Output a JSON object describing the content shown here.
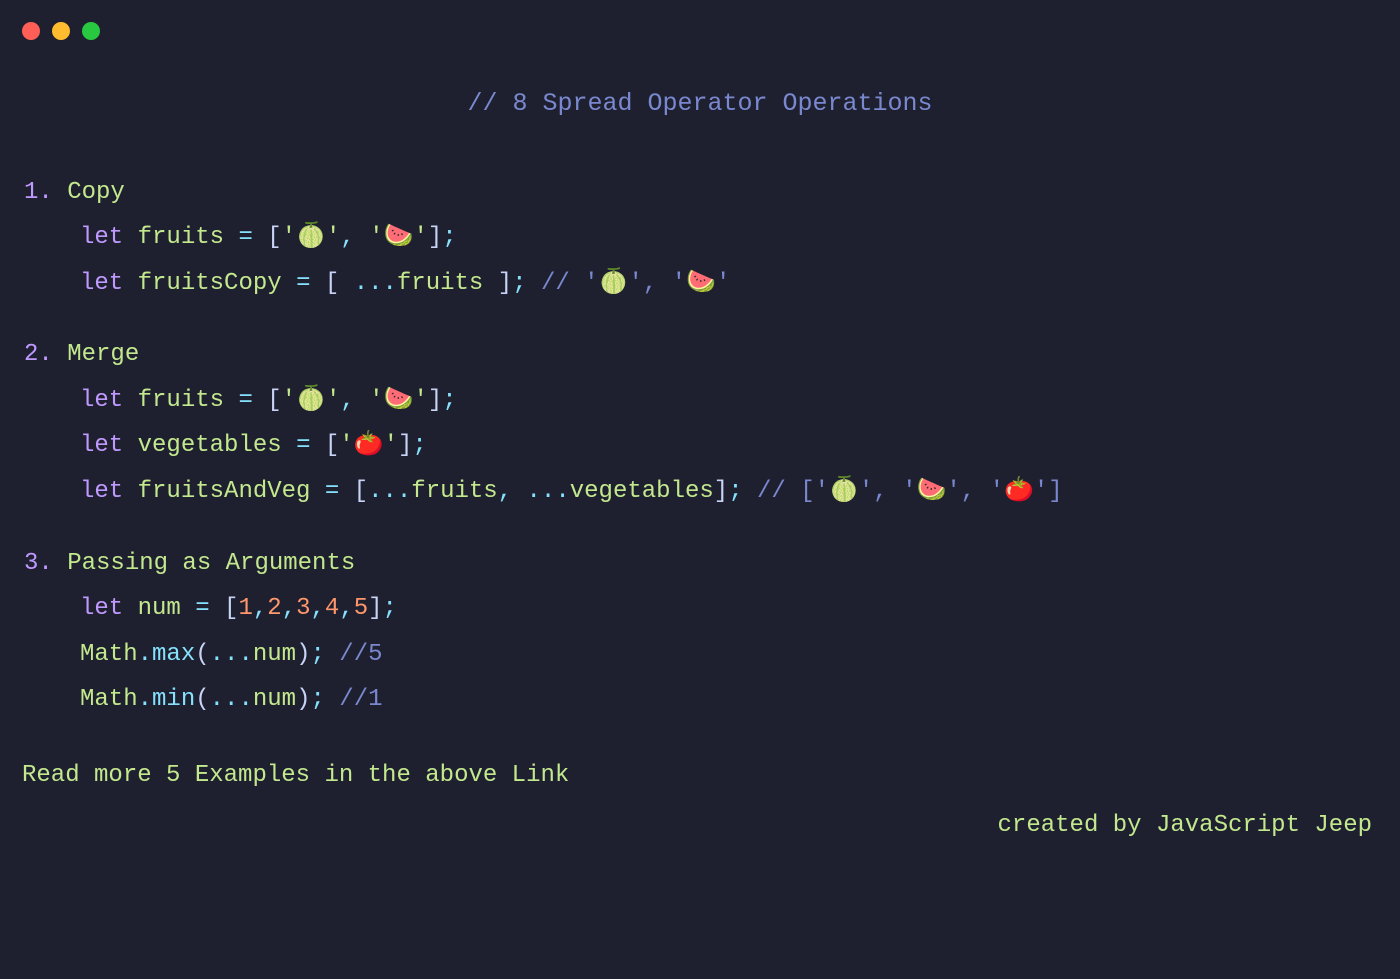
{
  "title_comment": "// 8 Spread Operator Operations",
  "sections": [
    {
      "num": "1.",
      "title": " Copy",
      "lines": [
        {
          "tokens": [
            {
              "c": "kw",
              "t": "let"
            },
            {
              "c": "text",
              "t": " "
            },
            {
              "c": "var",
              "t": "fruits"
            },
            {
              "c": "text",
              "t": " "
            },
            {
              "c": "punct",
              "t": "="
            },
            {
              "c": "text",
              "t": " ["
            },
            {
              "c": "str",
              "t": "'🍈'"
            },
            {
              "c": "punct",
              "t": ","
            },
            {
              "c": "text",
              "t": " "
            },
            {
              "c": "str",
              "t": "'🍉'"
            },
            {
              "c": "text",
              "t": "]"
            },
            {
              "c": "punct",
              "t": ";"
            }
          ]
        },
        {
          "tokens": [
            {
              "c": "kw",
              "t": "let"
            },
            {
              "c": "text",
              "t": " "
            },
            {
              "c": "var",
              "t": "fruitsCopy"
            },
            {
              "c": "text",
              "t": " "
            },
            {
              "c": "punct",
              "t": "="
            },
            {
              "c": "text",
              "t": " [ "
            },
            {
              "c": "punct",
              "t": "..."
            },
            {
              "c": "var",
              "t": "fruits"
            },
            {
              "c": "text",
              "t": " ]"
            },
            {
              "c": "punct",
              "t": ";"
            },
            {
              "c": "text",
              "t": " "
            },
            {
              "c": "comment",
              "t": "//  '🍈', '🍉'"
            }
          ]
        }
      ]
    },
    {
      "num": "2.",
      "title": " Merge",
      "lines": [
        {
          "tokens": [
            {
              "c": "kw",
              "t": "let"
            },
            {
              "c": "text",
              "t": " "
            },
            {
              "c": "var",
              "t": "fruits"
            },
            {
              "c": "text",
              "t": " "
            },
            {
              "c": "punct",
              "t": "="
            },
            {
              "c": "text",
              "t": " ["
            },
            {
              "c": "str",
              "t": "'🍈'"
            },
            {
              "c": "punct",
              "t": ","
            },
            {
              "c": "text",
              "t": " "
            },
            {
              "c": "str",
              "t": "'🍉'"
            },
            {
              "c": "text",
              "t": "]"
            },
            {
              "c": "punct",
              "t": ";"
            }
          ]
        },
        {
          "tokens": [
            {
              "c": "kw",
              "t": "let"
            },
            {
              "c": "text",
              "t": " "
            },
            {
              "c": "var",
              "t": "vegetables"
            },
            {
              "c": "text",
              "t": " "
            },
            {
              "c": "punct",
              "t": "="
            },
            {
              "c": "text",
              "t": " ["
            },
            {
              "c": "str",
              "t": "'🍅'"
            },
            {
              "c": "text",
              "t": "]"
            },
            {
              "c": "punct",
              "t": ";"
            }
          ]
        },
        {
          "tokens": [
            {
              "c": "kw",
              "t": "let"
            },
            {
              "c": "text",
              "t": " "
            },
            {
              "c": "var",
              "t": "fruitsAndVeg"
            },
            {
              "c": "text",
              "t": " "
            },
            {
              "c": "punct",
              "t": "="
            },
            {
              "c": "text",
              "t": " ["
            },
            {
              "c": "punct",
              "t": "..."
            },
            {
              "c": "var",
              "t": "fruits"
            },
            {
              "c": "punct",
              "t": ","
            },
            {
              "c": "text",
              "t": " "
            },
            {
              "c": "punct",
              "t": "..."
            },
            {
              "c": "var",
              "t": "vegetables"
            },
            {
              "c": "text",
              "t": "]"
            },
            {
              "c": "punct",
              "t": ";"
            },
            {
              "c": "text",
              "t": " "
            },
            {
              "c": "comment",
              "t": "// ['🍈', '🍉', '🍅']"
            }
          ]
        }
      ]
    },
    {
      "num": "3.",
      "title": " Passing as Arguments",
      "lines": [
        {
          "tokens": [
            {
              "c": "kw",
              "t": "let"
            },
            {
              "c": "text",
              "t": " "
            },
            {
              "c": "var",
              "t": "num"
            },
            {
              "c": "text",
              "t": " "
            },
            {
              "c": "punct",
              "t": "="
            },
            {
              "c": "text",
              "t": " ["
            },
            {
              "c": "number",
              "t": "1"
            },
            {
              "c": "punct",
              "t": ","
            },
            {
              "c": "number",
              "t": "2"
            },
            {
              "c": "punct",
              "t": ","
            },
            {
              "c": "number",
              "t": "3"
            },
            {
              "c": "punct",
              "t": ","
            },
            {
              "c": "number",
              "t": "4"
            },
            {
              "c": "punct",
              "t": ","
            },
            {
              "c": "number",
              "t": "5"
            },
            {
              "c": "text",
              "t": "]"
            },
            {
              "c": "punct",
              "t": ";"
            }
          ]
        },
        {
          "tokens": [
            {
              "c": "var",
              "t": "Math"
            },
            {
              "c": "punct",
              "t": "."
            },
            {
              "c": "punct",
              "t": "max"
            },
            {
              "c": "text",
              "t": "("
            },
            {
              "c": "punct",
              "t": "..."
            },
            {
              "c": "var",
              "t": "num"
            },
            {
              "c": "text",
              "t": ")"
            },
            {
              "c": "punct",
              "t": ";"
            },
            {
              "c": "text",
              "t": " "
            },
            {
              "c": "comment",
              "t": "//5"
            }
          ]
        },
        {
          "tokens": [
            {
              "c": "var",
              "t": "Math"
            },
            {
              "c": "punct",
              "t": "."
            },
            {
              "c": "punct",
              "t": "min"
            },
            {
              "c": "text",
              "t": "("
            },
            {
              "c": "punct",
              "t": "..."
            },
            {
              "c": "var",
              "t": "num"
            },
            {
              "c": "text",
              "t": ")"
            },
            {
              "c": "punct",
              "t": ";"
            },
            {
              "c": "text",
              "t": " "
            },
            {
              "c": "comment",
              "t": "//1"
            }
          ]
        }
      ]
    }
  ],
  "link_text": "Read more 5 Examples in the above Link",
  "credit": "created by JavaScript Jeep"
}
